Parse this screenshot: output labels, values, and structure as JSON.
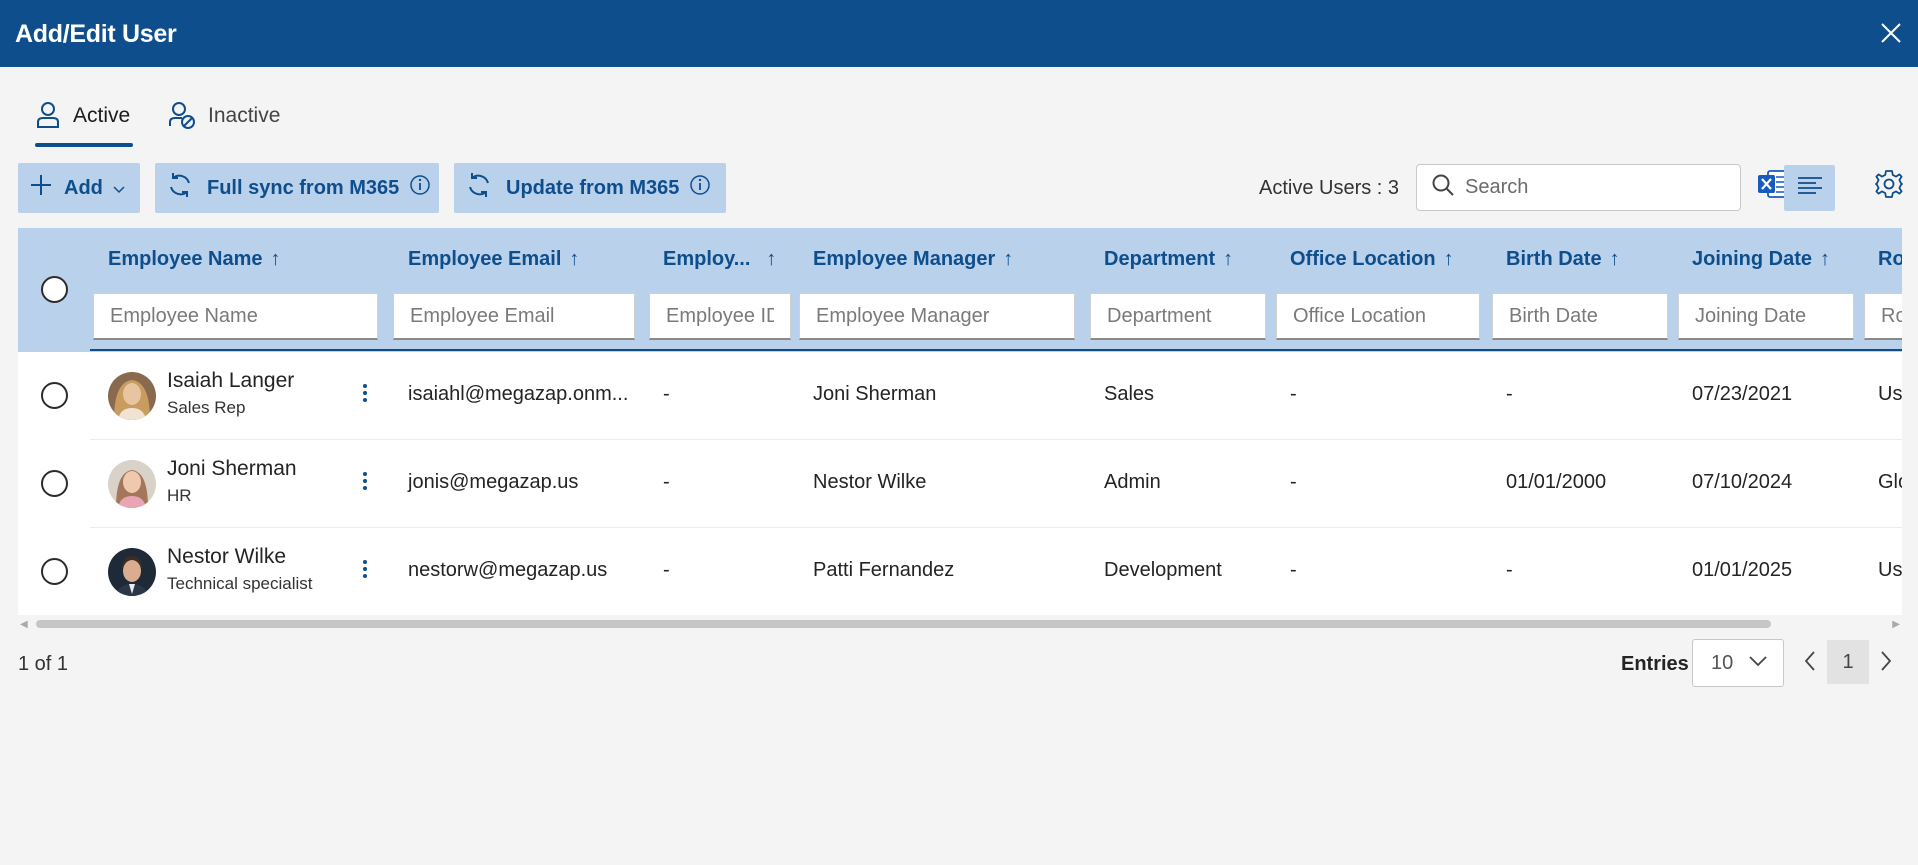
{
  "window": {
    "title": "Add/Edit User"
  },
  "tabs": [
    {
      "label": "Active",
      "icon": "person-icon",
      "selected": true
    },
    {
      "label": "Inactive",
      "icon": "person-disabled-icon",
      "selected": false
    }
  ],
  "toolbar": {
    "add_label": "Add",
    "full_sync_label": "Full sync from M365",
    "update_label": "Update from M365",
    "active_users_text": "Active Users : 3",
    "search_placeholder": "Search"
  },
  "table": {
    "columns": [
      {
        "title": "Employee Name",
        "filter_placeholder": "Employee Name"
      },
      {
        "title": "Employee Email",
        "filter_placeholder": "Employee Email"
      },
      {
        "title": "Employ...",
        "filter_placeholder": "Employee ID"
      },
      {
        "title": "Employee Manager",
        "filter_placeholder": "Employee Manager"
      },
      {
        "title": "Department",
        "filter_placeholder": "Department"
      },
      {
        "title": "Office Location",
        "filter_placeholder": "Office Location"
      },
      {
        "title": "Birth Date",
        "filter_placeholder": "Birth Date"
      },
      {
        "title": "Joining Date",
        "filter_placeholder": "Joining Date"
      },
      {
        "title": "Ro",
        "filter_placeholder": "Ro"
      }
    ],
    "sort_arrow": "↑",
    "rows": [
      {
        "name": "Isaiah Langer",
        "role": "Sales Rep",
        "email": "isaiahl@megazap.onm...",
        "employee_id": "-",
        "manager": "Joni Sherman",
        "department": "Sales",
        "office_location": "-",
        "birth_date": "-",
        "joining_date": "07/23/2021",
        "ro": "Us"
      },
      {
        "name": "Joni Sherman",
        "role": "HR",
        "email": "jonis@megazap.us",
        "employee_id": "-",
        "manager": "Nestor Wilke",
        "department": "Admin",
        "office_location": "-",
        "birth_date": "01/01/2000",
        "joining_date": "07/10/2024",
        "ro": "Glo"
      },
      {
        "name": "Nestor Wilke",
        "role": "Technical specialist",
        "email": "nestorw@megazap.us",
        "employee_id": "-",
        "manager": "Patti Fernandez",
        "department": "Development",
        "office_location": "-",
        "birth_date": "-",
        "joining_date": "01/01/2025",
        "ro": "Us"
      }
    ]
  },
  "footer": {
    "page_info": "1 of 1",
    "entries_label": "Entries",
    "entries_value": "10",
    "current_page": "1"
  },
  "colors": {
    "header_bg": "#0e4e8c",
    "accent": "#0e4e8c",
    "button_bg": "#b9d1ea",
    "table_header_bg": "#b9d1ea",
    "page_bg": "#f4f4f4",
    "excel_green": "#185abd"
  }
}
